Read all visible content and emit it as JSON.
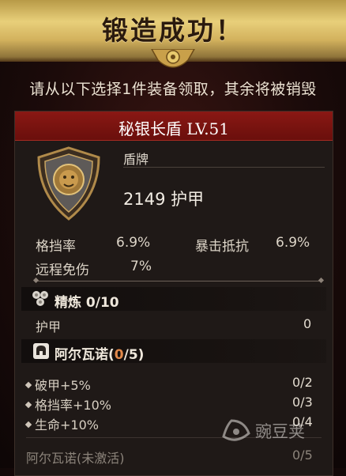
{
  "banner": {
    "title": "锻造成功！"
  },
  "subtitle": "请从以下选择1件装备领取，其余将被销毁",
  "item": {
    "name": "秘银长盾 LV.51",
    "type": "盾牌",
    "armor": "2149 护甲"
  },
  "stats": {
    "block_label": "格挡率",
    "block_value": "6.9%",
    "crit_res_label": "暴击抵抗",
    "crit_res_value": "6.9%",
    "ranged_label": "远程免伤",
    "ranged_value": "7%"
  },
  "refine": {
    "title": "精炼 0/10",
    "row_label": "护甲",
    "row_value": "0"
  },
  "set": {
    "title_prefix": "阿尔瓦诺(",
    "title_count": "0",
    "title_suffix": "/5)",
    "bonuses": [
      {
        "label": "破甲+5%",
        "value": "0/2"
      },
      {
        "label": "格挡率+10%",
        "value": "0/3"
      },
      {
        "label": "生命+10%",
        "value": "0/4"
      }
    ],
    "inactive_label": "阿尔瓦诺(未激活)",
    "inactive_value": "0/5"
  },
  "watermark": {
    "text": "豌豆荚"
  },
  "colors": {
    "header_red": "#7a1310",
    "gold": "#d8bb66",
    "set_count": "#e2894a"
  }
}
